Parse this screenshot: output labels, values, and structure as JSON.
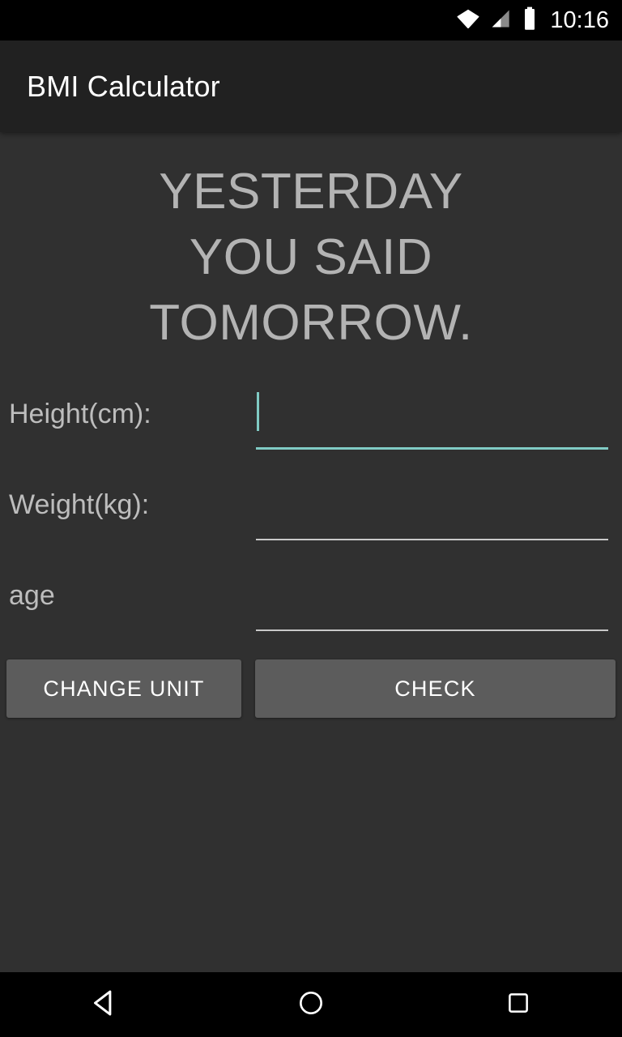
{
  "status_bar": {
    "time": "10:16",
    "icons": [
      "wifi-icon",
      "cell-signal-icon",
      "battery-icon"
    ],
    "background_color": "#000000",
    "text_color": "#ffffff"
  },
  "app_bar": {
    "title": "BMI Calculator",
    "background_color": "#212121",
    "title_color": "#ffffff"
  },
  "content": {
    "background_color": "#303030",
    "headline": {
      "lines": [
        "YESTERDAY",
        "YOU SAID",
        "TOMORROW."
      ],
      "color": "#b3b3b3"
    },
    "fields": [
      {
        "label": "Height(cm):",
        "value": "",
        "placeholder": "",
        "focused": true,
        "underline_color": "#80cbc4"
      },
      {
        "label": "Weight(kg):",
        "value": "",
        "placeholder": "",
        "focused": false,
        "underline_color": "#c9c9c9"
      },
      {
        "label": "age",
        "value": "",
        "placeholder": "",
        "focused": false,
        "underline_color": "#c9c9c9"
      }
    ],
    "buttons": {
      "change_unit_label": "CHANGE UNIT",
      "check_label": "CHECK",
      "background_color": "#5c5c5c",
      "text_color": "#ffffff"
    }
  },
  "nav_bar": {
    "background_color": "#000000",
    "items": [
      {
        "name": "back-nav-icon"
      },
      {
        "name": "home-nav-icon"
      },
      {
        "name": "recents-nav-icon"
      }
    ]
  }
}
